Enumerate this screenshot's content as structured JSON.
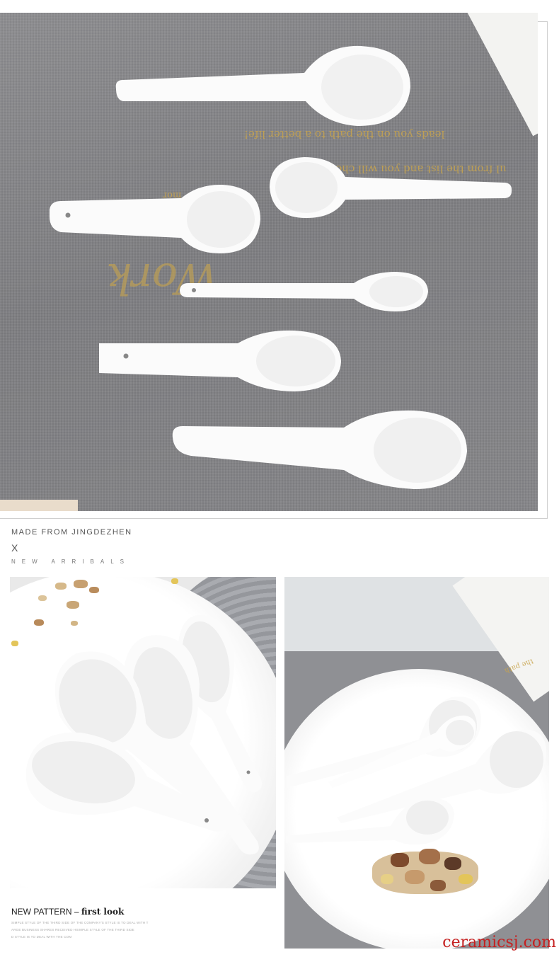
{
  "hero": {
    "printed_lines": [
      "leads you on the path to a better life!",
      "ul from the list and you will choose tea",
      "mor",
      "Work"
    ]
  },
  "captions": {
    "made_from": "MADE FROM JINGDEZHEN",
    "x_mark": "X",
    "new_arrivals": "NEW ARRIBALS",
    "pattern_lead": "NEW PATTERN",
    "pattern_dash": " – ",
    "pattern_strong": "first look",
    "small_line_1": "SIMPLE STYLE OF THE THIRD SIDE OF THE COMPANY'S STYLE IS TO DEAL WITH T",
    "small_line_2": "ARGE BUSINESS SHARES RECEIVED HSIMPLE STYLE OF THE THIRD SIDE",
    "small_line_3": "D STYLE IS TO DEAL WITH THE COM"
  },
  "photo_right": {
    "printed_text": "the path"
  },
  "watermark": "ceramicsj.com",
  "colors": {
    "cloth": "#838386",
    "gold_text": "#c9a54d",
    "watermark": "#c52020"
  }
}
